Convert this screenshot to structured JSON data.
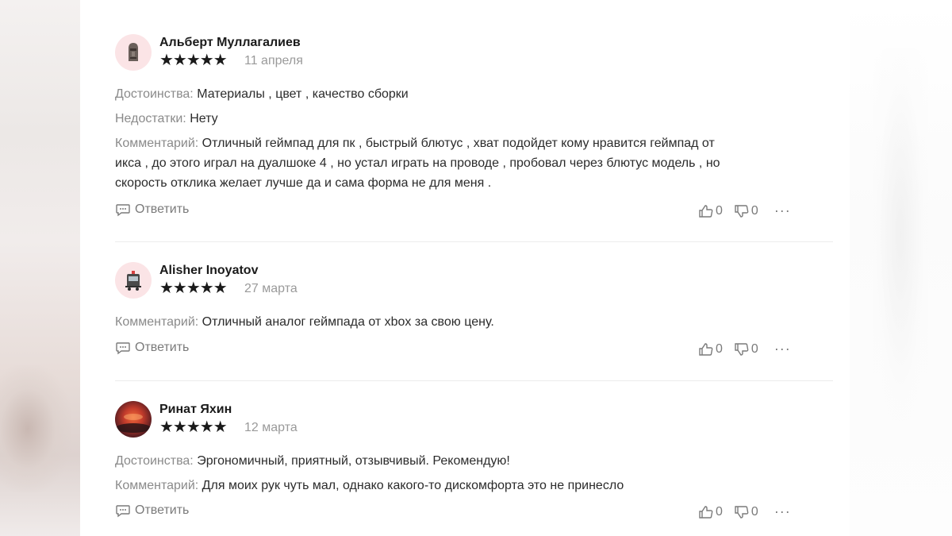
{
  "reviews": [
    {
      "author": "Альберт Муллагалиев",
      "stars": "★★★★★",
      "date": "11 апреля",
      "avatar_icon": "moai-statue-icon",
      "pros_label": "Достоинства:",
      "pros": "Материалы , цвет , качество сборки",
      "cons_label": "Недостатки:",
      "cons": "Нету",
      "comment_label": "Комментарий:",
      "comment_lines": [
        "Отличный геймпад для пк , быстрый блютус , хват подойдет кому нравится геймпад от",
        "икса , до этого играл на дуалшоке 4 , но устал играть на проводе , пробовал через блютус модель , но",
        "скорость отклика желает лучше да и сама форма не для меня ."
      ],
      "reply_label": "Ответить",
      "likes": "0",
      "dislikes": "0",
      "more": "···"
    },
    {
      "author": "Alisher Inoyatov",
      "stars": "★★★★★",
      "date": "27 марта",
      "avatar_icon": "train-icon",
      "comment_label": "Комментарий:",
      "comment": "Отличный аналог геймпада от xbox за свою цену.",
      "reply_label": "Ответить",
      "likes": "0",
      "dislikes": "0",
      "more": "···"
    },
    {
      "author": "Ринат Яхин",
      "stars": "★★★★★",
      "date": "12 марта",
      "avatar_icon": "sunset-photo",
      "pros_label": "Достоинства:",
      "pros": "Эргономичный, приятный, отзывчивый. Рекомендую!",
      "comment_label": "Комментарий:",
      "comment": "Для моих рук чуть мал, однако какого-то дискомфорта это не принесло",
      "reply_label": "Ответить",
      "likes": "0",
      "dislikes": "0",
      "more": "···"
    }
  ],
  "colors": {
    "text": "#2b2b2b",
    "label": "#8a8a8a",
    "muted": "#9a9a9a",
    "avatar_bg": "#fbe4e6"
  }
}
